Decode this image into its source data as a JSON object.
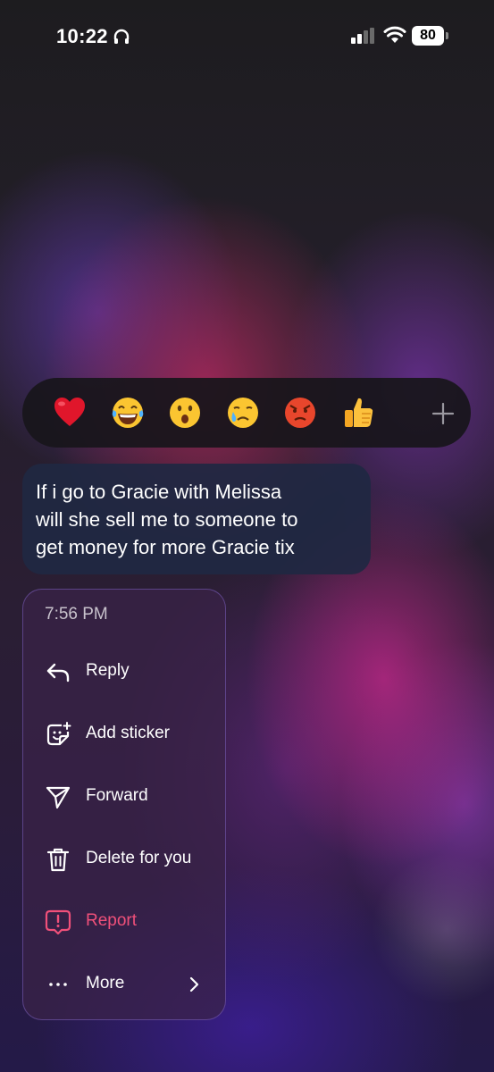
{
  "status_bar": {
    "time": "10:22",
    "battery": "80"
  },
  "reactions": {
    "emojis": [
      "❤️",
      "😂",
      "😮",
      "😢",
      "😡",
      "👍"
    ],
    "more_icon": "plus-icon"
  },
  "message": {
    "lines": [
      "If i go to Gracie with Melissa",
      "will she sell me to someone to",
      "get money for more Gracie tix"
    ]
  },
  "menu": {
    "timestamp": "7:56 PM",
    "items": [
      {
        "label": "Reply",
        "icon": "reply-icon"
      },
      {
        "label": "Add sticker",
        "icon": "sticker-icon"
      },
      {
        "label": "Forward",
        "icon": "forward-icon"
      },
      {
        "label": "Delete for you",
        "icon": "trash-icon"
      },
      {
        "label": "Report",
        "icon": "report-icon",
        "color": "#f0507a"
      },
      {
        "label": "More",
        "icon": "more-icon"
      }
    ]
  }
}
